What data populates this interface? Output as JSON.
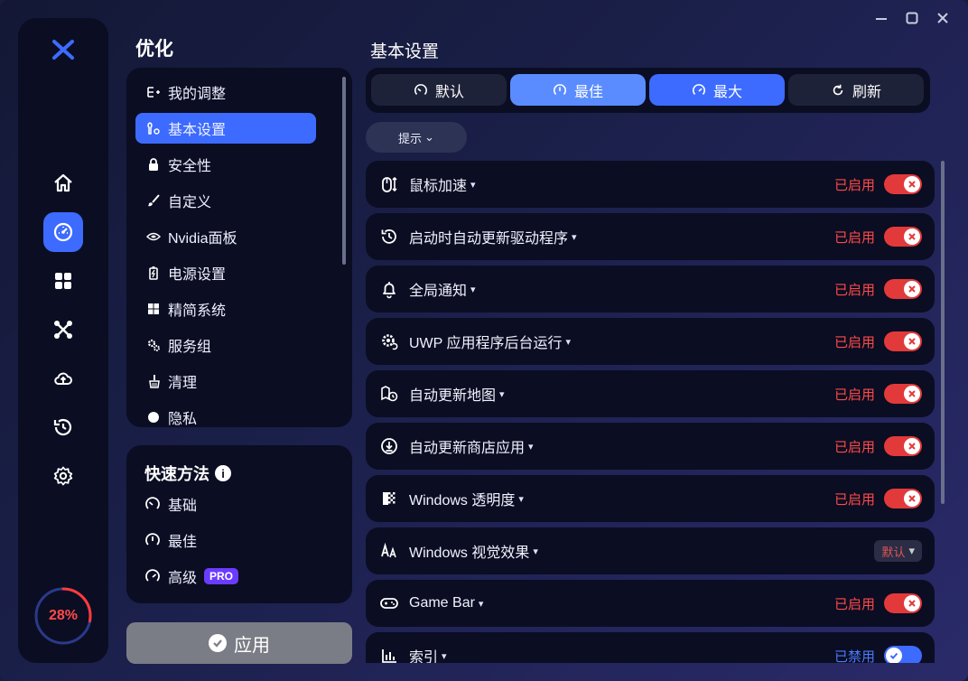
{
  "colors": {
    "accent": "#3d6bff",
    "enabled": "#ff4a4a",
    "disabled": "#4a7bff",
    "panel": "#0b0d22"
  },
  "rail": {
    "logo": "x-logo-icon",
    "items": [
      {
        "icon": "home-icon"
      },
      {
        "icon": "dashboard-icon",
        "active": true
      },
      {
        "icon": "apps-grid-icon"
      },
      {
        "icon": "network-icon"
      },
      {
        "icon": "cloud-upload-icon"
      },
      {
        "icon": "restore-history-icon"
      },
      {
        "icon": "settings-gear-icon"
      }
    ],
    "progress": {
      "value": 0.28,
      "label": "28%"
    }
  },
  "sidebar": {
    "title": "优化",
    "items": [
      {
        "label": "我的调整",
        "icon": "list-add-icon"
      },
      {
        "label": "基本设置",
        "icon": "tools-icon",
        "active": true
      },
      {
        "label": "安全性",
        "icon": "lock-icon"
      },
      {
        "label": "自定义",
        "icon": "brush-icon"
      },
      {
        "label": "Nvidia面板",
        "icon": "nvidia-icon"
      },
      {
        "label": "电源设置",
        "icon": "battery-icon"
      },
      {
        "label": "精简系统",
        "icon": "windows-icon"
      },
      {
        "label": "服务组",
        "icon": "gears-icon"
      },
      {
        "label": "清理",
        "icon": "broom-icon"
      },
      {
        "label": "隐私",
        "icon": "privacy-icon"
      }
    ]
  },
  "quick": {
    "title": "快速方法",
    "info": "i",
    "items": [
      {
        "label": "基础",
        "icon": "gauge-low-icon"
      },
      {
        "label": "最佳",
        "icon": "gauge-mid-icon"
      },
      {
        "label": "高级",
        "icon": "gauge-high-icon",
        "badge": "PRO"
      }
    ]
  },
  "apply": {
    "label": "应用"
  },
  "main": {
    "title": "基本设置",
    "presets": [
      {
        "label": "默认",
        "icon": "gauge-low-icon"
      },
      {
        "label": "最佳",
        "icon": "gauge-mid-icon"
      },
      {
        "label": "最大",
        "icon": "gauge-high-icon"
      },
      {
        "label": "刷新",
        "icon": "refresh-icon"
      }
    ],
    "hint": {
      "label": "提示",
      "chevron": "⌄"
    },
    "settings": [
      {
        "label": "鼠标加速",
        "icon": "mouse-icon",
        "status": "已启用",
        "state": "enabled"
      },
      {
        "label": "启动时自动更新驱动程序",
        "icon": "update-clock-icon",
        "status": "已启用",
        "state": "enabled"
      },
      {
        "label": "全局通知",
        "icon": "bell-icon",
        "status": "已启用",
        "state": "enabled"
      },
      {
        "label": "UWP 应用程序后台运行",
        "icon": "gear-sync-icon",
        "status": "已启用",
        "state": "enabled"
      },
      {
        "label": "自动更新地图",
        "icon": "map-clock-icon",
        "status": "已启用",
        "state": "enabled"
      },
      {
        "label": "自动更新商店应用",
        "icon": "download-circle-icon",
        "status": "已启用",
        "state": "enabled"
      },
      {
        "label": "Windows 透明度",
        "icon": "transparency-icon",
        "status": "已启用",
        "state": "enabled"
      },
      {
        "label": "Windows 视觉效果",
        "icon": "visual-effects-icon",
        "status": "默认",
        "state": "default"
      },
      {
        "label": "Game Bar",
        "icon": "gamepad-icon",
        "status": "已启用",
        "state": "enabled"
      },
      {
        "label": "索引",
        "icon": "index-icon",
        "status": "已禁用",
        "state": "disabled"
      }
    ]
  }
}
